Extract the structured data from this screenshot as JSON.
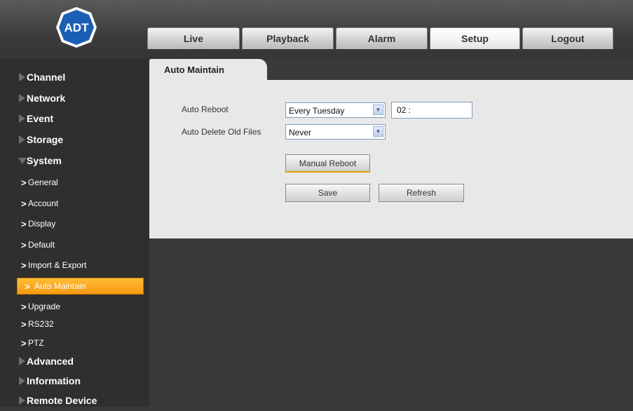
{
  "brand": {
    "logo_text": "ADT"
  },
  "nav_tabs": [
    {
      "label": "Live"
    },
    {
      "label": "Playback"
    },
    {
      "label": "Alarm"
    },
    {
      "label": "Setup",
      "active": true
    },
    {
      "label": "Logout"
    }
  ],
  "sidebar": {
    "channel": "Channel",
    "network": "Network",
    "event": "Event",
    "storage": "Storage",
    "system": "System",
    "system_items": {
      "general": "General",
      "account": "Account",
      "display": "Display",
      "default": "Default",
      "import_export": "Import & Export",
      "auto_maintain": "Auto Maintain",
      "upgrade": "Upgrade",
      "rs232": "RS232",
      "ptz": "PTZ"
    },
    "advanced": "Advanced",
    "information": "Information",
    "remote_device": "Remote Device",
    "chevron_glyph": ">"
  },
  "page": {
    "tab_title": "Auto Maintain",
    "auto_reboot_label": "Auto Reboot",
    "auto_reboot_day": "Every Tuesday",
    "auto_reboot_time": "02 :",
    "auto_delete_label": "Auto Delete Old Files",
    "auto_delete_value": "Never",
    "manual_reboot_label": "Manual Reboot",
    "save_label": "Save",
    "refresh_label": "Refresh",
    "dropdown_glyph": "▼"
  },
  "colors": {
    "active_item": "#f7a21b",
    "panel_bg": "#e8e8e8",
    "logo_blue": "#1a5fb4"
  }
}
